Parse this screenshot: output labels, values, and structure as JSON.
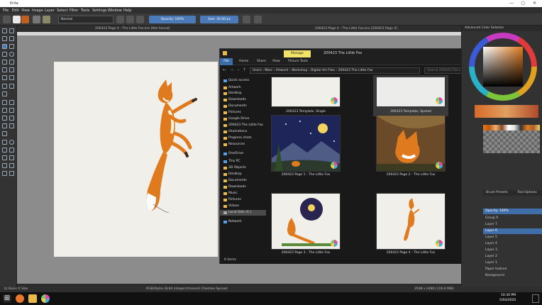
{
  "window": {
    "title": "Krita"
  },
  "menu": [
    "File",
    "Edit",
    "View",
    "Image",
    "Layer",
    "Select",
    "Filter",
    "Tools",
    "Settings",
    "Window",
    "Help"
  ],
  "toolbar": {
    "blend_mode": "Normal",
    "opacity_label": "Opacity: 100%",
    "size_label": "Size: 30.00 px"
  },
  "doc_tabs": {
    "left": "200423 Page 4 - The Little Fox.kra [Not Saved]",
    "right": "200423 Page 4 - The Little Fox.kra [200423 Page 4]"
  },
  "explorer": {
    "title": "200423 The Little Fox",
    "manage_tab": "Manage",
    "ribbon": [
      "File",
      "Home",
      "Share",
      "View",
      "Picture Tools"
    ],
    "breadcrumb": [
      "Users",
      "Marc",
      "Artwork",
      "Workshop",
      "Digital Art Files",
      "200423 The Little Fox"
    ],
    "search_placeholder": "Search 200423 The Little Fox",
    "nav": [
      {
        "label": "Quick access",
        "type": "star"
      },
      {
        "label": "Artwork",
        "type": "folder"
      },
      {
        "label": "Desktop",
        "type": "folder"
      },
      {
        "label": "Downloads",
        "type": "folder"
      },
      {
        "label": "Documents",
        "type": "folder"
      },
      {
        "label": "Pictures",
        "type": "folder"
      },
      {
        "label": "Google Drive",
        "type": "folder"
      },
      {
        "label": "200423 The Little Fox",
        "type": "folder"
      },
      {
        "label": "Illustrations",
        "type": "folder"
      },
      {
        "label": "Progress shots",
        "type": "folder"
      },
      {
        "label": "Resources",
        "type": "folder"
      },
      {
        "label": "OneDrive",
        "type": "cloud"
      },
      {
        "label": "This PC",
        "type": "pc"
      },
      {
        "label": "3D Objects",
        "type": "folder"
      },
      {
        "label": "Desktop",
        "type": "folder"
      },
      {
        "label": "Documents",
        "type": "folder"
      },
      {
        "label": "Downloads",
        "type": "folder"
      },
      {
        "label": "Music",
        "type": "folder"
      },
      {
        "label": "Pictures",
        "type": "folder"
      },
      {
        "label": "Videos",
        "type": "folder"
      },
      {
        "label": "Local Disk (C:)",
        "type": "disk"
      },
      {
        "label": "Network",
        "type": "network"
      }
    ],
    "files": [
      {
        "name": "200323 Template, Single",
        "kind": "blank"
      },
      {
        "name": "200323 Template, Spread",
        "kind": "blank-selected"
      },
      {
        "name": "200423 Page 1 - The Little Fox",
        "kind": "night"
      },
      {
        "name": "200423 Page 2 - The Little Fox",
        "kind": "fox-close"
      },
      {
        "name": "200423 Page 3 - The Little Fox",
        "kind": "dream"
      },
      {
        "name": "200423 Page 4 - The Little Fox",
        "kind": "jump"
      }
    ],
    "status": "6 items"
  },
  "dockers": {
    "color_title": "Advanced Color Selector",
    "tabs_mid": [
      "Brush Presets",
      "Tool Options"
    ],
    "layer_opacity": "Opacity: 100%",
    "layers": [
      "Group 9",
      "Layer 7",
      "Layer 6",
      "Layer 5",
      "Layer 4",
      "Layer 3",
      "Layer 2",
      "Layer 1",
      "Paper texture",
      "Background"
    ]
  },
  "statusbar": {
    "left": "b) Basic-5 Size",
    "center": "RGB/Alpha (8-bit integer/channel)  Chemise Spread",
    "right": "3508 x 2480 (119.4 MiB)"
  },
  "taskbar": {
    "time": "10:30 PM",
    "date": "5/04/2020"
  },
  "colors": {
    "accent": "#3f6ea8",
    "paper": "#f1efe9",
    "fox": "#e07a1f"
  }
}
